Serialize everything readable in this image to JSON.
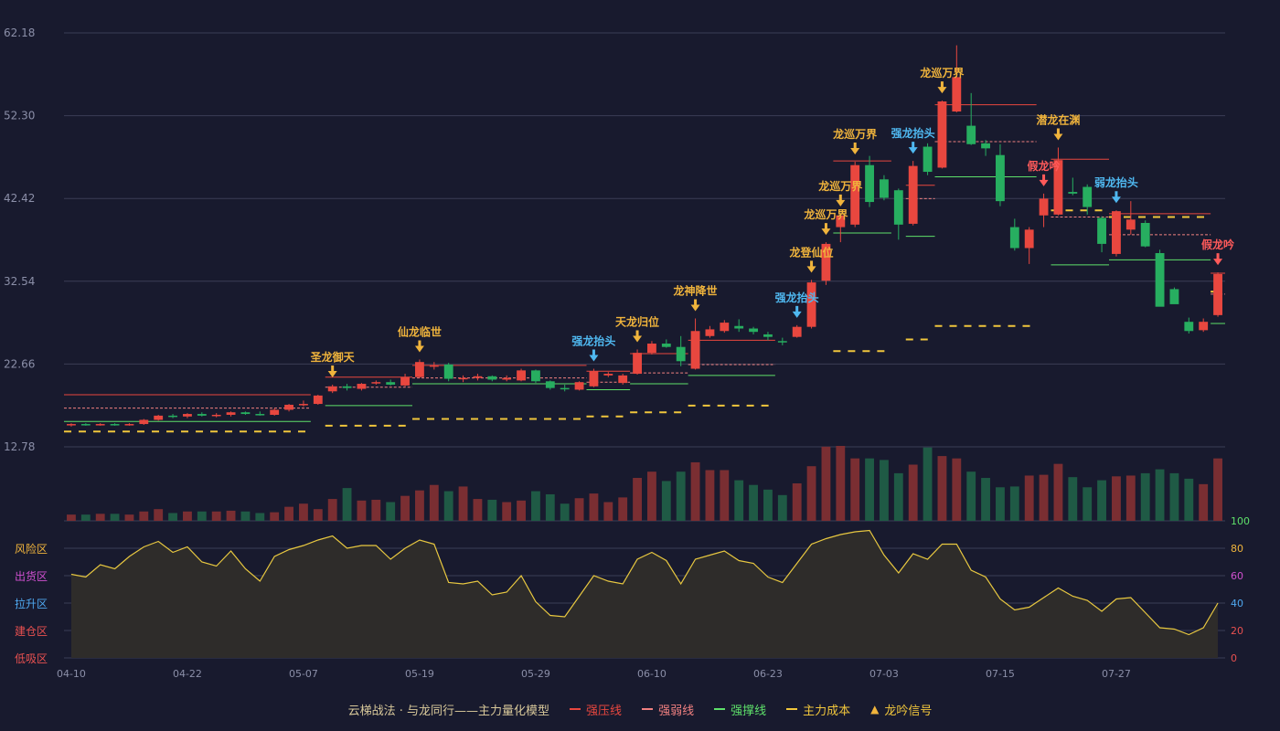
{
  "colors": {
    "background": "#181a2e",
    "up": "#e8473f",
    "down": "#27ae60",
    "vol_up": "#7a2e32",
    "vol_down": "#1f5a45",
    "grid": "#3a3d55",
    "axis_text": "#8b8fa8",
    "strong_pressure": "#e8473f",
    "strong_weak": "#f08080",
    "strong_support": "#5ee06a",
    "main_cost": "#f0c63c",
    "signal_gold": "#f0b43c",
    "signal_blue": "#4fb8f0",
    "signal_red": "#ff5a5a",
    "risk_line": "#e8c840",
    "risk_fill": "#2e2c2a"
  },
  "chart_data": {
    "type": "candlestick",
    "y_ticks": [
      12.78,
      22.66,
      32.54,
      42.42,
      52.3,
      62.18
    ],
    "y_range": [
      12.78,
      62.18
    ],
    "x_tick_labels": [
      "04-10",
      "04-22",
      "05-07",
      "05-19",
      "05-29",
      "06-10",
      "06-23",
      "07-03",
      "07-15",
      "07-27"
    ],
    "x_tick_index": [
      0,
      8,
      16,
      24,
      32,
      40,
      48,
      56,
      64,
      72
    ],
    "ohlc": [
      [
        15.4,
        15.6,
        15.2,
        15.5
      ],
      [
        15.5,
        15.6,
        15.3,
        15.4
      ],
      [
        15.4,
        15.6,
        15.3,
        15.5
      ],
      [
        15.5,
        15.6,
        15.3,
        15.4
      ],
      [
        15.4,
        15.6,
        15.3,
        15.5
      ],
      [
        15.5,
        16.1,
        15.4,
        16.0
      ],
      [
        16.0,
        16.6,
        15.9,
        16.5
      ],
      [
        16.5,
        16.7,
        16.2,
        16.4
      ],
      [
        16.4,
        16.8,
        16.2,
        16.7
      ],
      [
        16.7,
        16.9,
        16.4,
        16.5
      ],
      [
        16.5,
        16.8,
        16.3,
        16.6
      ],
      [
        16.6,
        17.0,
        16.4,
        16.9
      ],
      [
        16.9,
        17.0,
        16.6,
        16.7
      ],
      [
        16.7,
        17.0,
        16.5,
        16.6
      ],
      [
        16.6,
        17.4,
        16.5,
        17.2
      ],
      [
        17.2,
        17.9,
        17.0,
        17.8
      ],
      [
        17.8,
        18.3,
        17.6,
        17.9
      ],
      [
        17.9,
        19.0,
        17.8,
        18.9
      ],
      [
        19.4,
        20.2,
        19.2,
        20.0
      ],
      [
        20.0,
        20.3,
        19.5,
        19.8
      ],
      [
        19.7,
        20.4,
        19.5,
        20.3
      ],
      [
        20.4,
        20.7,
        20.2,
        20.5
      ],
      [
        20.5,
        20.8,
        20.1,
        20.2
      ],
      [
        20.1,
        21.5,
        20.0,
        21.1
      ],
      [
        21.1,
        23.2,
        21.0,
        22.9
      ],
      [
        22.4,
        22.9,
        22.0,
        22.5
      ],
      [
        22.6,
        22.8,
        20.6,
        20.9
      ],
      [
        20.9,
        21.3,
        20.5,
        21.0
      ],
      [
        21.0,
        21.5,
        20.7,
        21.2
      ],
      [
        21.2,
        21.3,
        20.6,
        20.8
      ],
      [
        20.8,
        21.3,
        20.6,
        21.0
      ],
      [
        20.7,
        22.1,
        20.6,
        21.9
      ],
      [
        21.9,
        22.0,
        20.4,
        20.6
      ],
      [
        20.6,
        20.7,
        19.6,
        19.8
      ],
      [
        19.8,
        20.2,
        19.4,
        19.7
      ],
      [
        19.6,
        20.6,
        19.5,
        20.5
      ],
      [
        20.0,
        22.1,
        19.9,
        21.8
      ],
      [
        21.3,
        21.7,
        21.1,
        21.5
      ],
      [
        20.4,
        21.5,
        20.2,
        21.3
      ],
      [
        21.5,
        24.4,
        21.4,
        24.0
      ],
      [
        24.0,
        25.4,
        23.8,
        25.1
      ],
      [
        25.1,
        25.6,
        24.6,
        24.7
      ],
      [
        24.7,
        26.0,
        22.4,
        23.0
      ],
      [
        22.1,
        28.1,
        22.0,
        26.6
      ],
      [
        26.0,
        27.2,
        25.8,
        26.8
      ],
      [
        26.6,
        27.9,
        26.4,
        27.6
      ],
      [
        27.2,
        28.0,
        26.5,
        26.9
      ],
      [
        26.9,
        27.1,
        26.2,
        26.5
      ],
      [
        26.2,
        26.5,
        25.5,
        25.9
      ],
      [
        25.4,
        25.8,
        24.9,
        25.3
      ],
      [
        25.9,
        27.3,
        25.8,
        27.1
      ],
      [
        27.1,
        32.7,
        26.9,
        32.4
      ],
      [
        32.6,
        37.2,
        32.1,
        37.0
      ],
      [
        39.0,
        40.6,
        37.2,
        40.4
      ],
      [
        39.3,
        46.8,
        39.0,
        46.4
      ],
      [
        46.4,
        47.5,
        41.4,
        42.0
      ],
      [
        44.7,
        45.2,
        42.2,
        42.5
      ],
      [
        43.4,
        43.6,
        37.5,
        39.3
      ],
      [
        39.4,
        46.9,
        39.2,
        46.3
      ],
      [
        48.6,
        49.0,
        45.2,
        45.6
      ],
      [
        46.1,
        54.1,
        46.0,
        54.0
      ],
      [
        52.8,
        60.7,
        52.7,
        56.9
      ],
      [
        51.1,
        55.0,
        48.8,
        48.9
      ],
      [
        49.0,
        49.4,
        47.5,
        48.4
      ],
      [
        47.6,
        48.9,
        41.5,
        42.1
      ],
      [
        39.0,
        40.0,
        36.2,
        36.5
      ],
      [
        36.5,
        39.0,
        34.6,
        38.7
      ],
      [
        40.4,
        43.0,
        39.0,
        42.4
      ],
      [
        40.5,
        48.5,
        40.4,
        47.0
      ],
      [
        43.2,
        44.9,
        42.8,
        43.0
      ],
      [
        43.8,
        44.1,
        40.5,
        41.4
      ],
      [
        40.1,
        40.3,
        36.0,
        37.0
      ],
      [
        35.8,
        41.0,
        35.5,
        40.9
      ],
      [
        38.7,
        42.1,
        38.1,
        39.9
      ],
      [
        39.5,
        39.8,
        36.6,
        36.7
      ],
      [
        35.9,
        36.3,
        30.2,
        29.5
      ],
      [
        31.6,
        31.8,
        29.9,
        29.8
      ],
      [
        27.7,
        28.2,
        26.3,
        26.6
      ],
      [
        26.7,
        28.1,
        26.5,
        27.7
      ],
      [
        28.5,
        33.6,
        28.3,
        33.4
      ]
    ],
    "volume": [
      8,
      8,
      9,
      9,
      8,
      12,
      15,
      10,
      12,
      12,
      12,
      13,
      12,
      10,
      11,
      18,
      22,
      15,
      28,
      42,
      26,
      27,
      24,
      32,
      39,
      46,
      38,
      44,
      28,
      27,
      24,
      26,
      38,
      34,
      22,
      29,
      35,
      24,
      30,
      55,
      63,
      51,
      63,
      75,
      65,
      65,
      52,
      46,
      40,
      33,
      48,
      70,
      95,
      96,
      80,
      80,
      78,
      61,
      72,
      94,
      83,
      80,
      63,
      55,
      43,
      44,
      58,
      59,
      73,
      56,
      43,
      52,
      57,
      58,
      61,
      66,
      61,
      54,
      47,
      80
    ],
    "risk": [
      61,
      59,
      68,
      65,
      74,
      81,
      85,
      77,
      81,
      70,
      67,
      78,
      65,
      56,
      74,
      79,
      82,
      86,
      89,
      80,
      82,
      82,
      72,
      80,
      86,
      83,
      55,
      54,
      56,
      46,
      48,
      60,
      41,
      31,
      30,
      45,
      60,
      56,
      54,
      72,
      77,
      71,
      54,
      72,
      75,
      78,
      71,
      69,
      59,
      55,
      69,
      83,
      87,
      90,
      92,
      93,
      75,
      62,
      76,
      72,
      83,
      83,
      64,
      59,
      43,
      35,
      37,
      44,
      51,
      45,
      42,
      34,
      43,
      44,
      33,
      22,
      21,
      17,
      22,
      40
    ],
    "risk_ticks": [
      0,
      20,
      40,
      60,
      80,
      100
    ],
    "risk_zones": [
      {
        "label": "风险区",
        "color": "#f0b43c"
      },
      {
        "label": "出货区",
        "color": "#d050d0"
      },
      {
        "label": "拉升区",
        "color": "#4fa8f0"
      },
      {
        "label": "建仓区",
        "color": "#e85050"
      },
      {
        "label": "低吸区",
        "color": "#e85050"
      }
    ],
    "signals": [
      {
        "i": 18,
        "label": "圣龙御天",
        "kind": "gold"
      },
      {
        "i": 24,
        "label": "仙龙临世",
        "kind": "gold"
      },
      {
        "i": 36,
        "label": "强龙抬头",
        "kind": "blue"
      },
      {
        "i": 39,
        "label": "天龙归位",
        "kind": "gold"
      },
      {
        "i": 43,
        "label": "龙神降世",
        "kind": "gold"
      },
      {
        "i": 50,
        "label": "强龙抬头",
        "kind": "blue"
      },
      {
        "i": 51,
        "label": "龙登仙位",
        "kind": "gold"
      },
      {
        "i": 52,
        "label": "龙巡万界",
        "kind": "gold"
      },
      {
        "i": 53,
        "label": "龙巡万界",
        "kind": "gold"
      },
      {
        "i": 54,
        "label": "龙巡万界",
        "kind": "gold"
      },
      {
        "i": 58,
        "label": "强龙抬头",
        "kind": "blue"
      },
      {
        "i": 60,
        "label": "龙巡万界",
        "kind": "gold"
      },
      {
        "i": 67,
        "label": "假龙吟",
        "kind": "red"
      },
      {
        "i": 68,
        "label": "潜龙在渊",
        "kind": "gold"
      },
      {
        "i": 72,
        "label": "弱龙抬头",
        "kind": "blue"
      },
      {
        "i": 79,
        "label": "假龙吟",
        "kind": "red"
      }
    ],
    "lines": {
      "pressure": [
        [
          0,
          16,
          19.0
        ],
        [
          18,
          23,
          21.1
        ],
        [
          24,
          35,
          22.5
        ],
        [
          36,
          38,
          21.8
        ],
        [
          39,
          42,
          23.9
        ],
        [
          43,
          48,
          25.5
        ],
        [
          53,
          56,
          46.9
        ],
        [
          58,
          59,
          44.0
        ],
        [
          60,
          66,
          53.6
        ],
        [
          68,
          71,
          47.1
        ],
        [
          72,
          78,
          40.6
        ],
        [
          79,
          79,
          33.5
        ]
      ],
      "weak": [
        [
          0,
          16,
          17.4
        ],
        [
          18,
          23,
          19.9
        ],
        [
          24,
          35,
          21.0
        ],
        [
          36,
          38,
          20.5
        ],
        [
          39,
          42,
          21.6
        ],
        [
          43,
          48,
          22.6
        ],
        [
          58,
          59,
          42.4
        ],
        [
          60,
          66,
          49.2
        ],
        [
          68,
          71,
          40.2
        ],
        [
          72,
          78,
          38.1
        ],
        [
          79,
          79,
          31.0
        ]
      ],
      "support": [
        [
          0,
          16,
          15.8
        ],
        [
          18,
          23,
          17.7
        ],
        [
          24,
          35,
          20.3
        ],
        [
          36,
          38,
          19.6
        ],
        [
          39,
          42,
          20.3
        ],
        [
          43,
          48,
          21.3
        ],
        [
          53,
          56,
          38.3
        ],
        [
          58,
          59,
          37.9
        ],
        [
          60,
          66,
          45.0
        ],
        [
          68,
          71,
          34.5
        ],
        [
          72,
          78,
          35.1
        ],
        [
          79,
          79,
          27.5
        ]
      ],
      "cost": [
        [
          0,
          16,
          14.6
        ],
        [
          18,
          23,
          15.3
        ],
        [
          24,
          35,
          16.1
        ],
        [
          36,
          38,
          16.4
        ],
        [
          39,
          42,
          16.9
        ],
        [
          43,
          48,
          17.7
        ],
        [
          53,
          56,
          24.2
        ],
        [
          58,
          59,
          25.6
        ],
        [
          60,
          66,
          27.2
        ],
        [
          68,
          71,
          41.0
        ],
        [
          72,
          78,
          40.2
        ],
        [
          79,
          79,
          31.3
        ]
      ]
    },
    "legend": [
      {
        "label": "云梯战法 · 与龙同行——主力量化模型",
        "type": "title"
      },
      {
        "label": "强压线",
        "type": "solid",
        "color": "#e8473f"
      },
      {
        "label": "强弱线",
        "type": "dashed",
        "color": "#f08080"
      },
      {
        "label": "强撑线",
        "type": "solid",
        "color": "#5ee06a"
      },
      {
        "label": "主力成本",
        "type": "dashed",
        "color": "#f0c63c"
      },
      {
        "label": "龙吟信号",
        "type": "triangle",
        "color": "#f0b43c"
      }
    ]
  }
}
